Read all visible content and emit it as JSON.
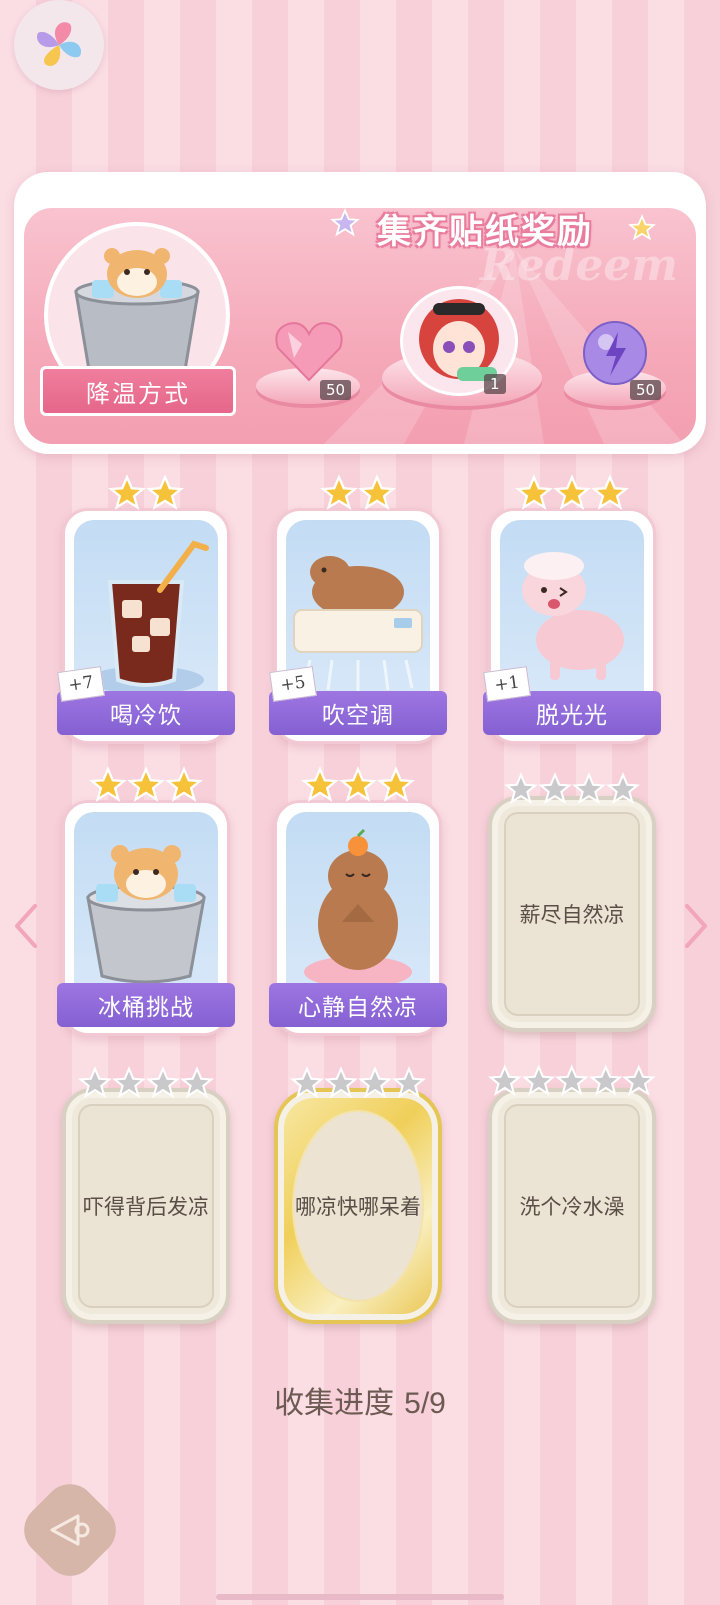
{
  "banner": {
    "title": "集齐贴纸奖励",
    "watermark": "Redeem",
    "method_label": "降温方式",
    "rewards": [
      {
        "icon": "pink-heart-gem-icon",
        "count": "50"
      },
      {
        "icon": "character-avatar-icon",
        "count": "1"
      },
      {
        "icon": "purple-energy-orb-icon",
        "count": "50"
      }
    ]
  },
  "cards": [
    {
      "label": "喝冷饮",
      "bonus": "+7",
      "stars": 2,
      "icon": "iced-cola-icon",
      "collected": true
    },
    {
      "label": "吹空调",
      "bonus": "+5",
      "stars": 2,
      "icon": "capybara-air-conditioner-icon",
      "collected": true
    },
    {
      "label": "脱光光",
      "bonus": "+1",
      "stars": 3,
      "icon": "sheared-sheep-icon",
      "collected": true
    },
    {
      "label": "冰桶挑战",
      "bonus": "",
      "stars": 3,
      "icon": "hamster-ice-bucket-icon",
      "collected": true
    },
    {
      "label": "心静自然凉",
      "bonus": "",
      "stars": 3,
      "icon": "meditating-capybara-icon",
      "collected": true
    },
    {
      "label": "薪尽自然凉",
      "stars": 4,
      "collected": false
    },
    {
      "label": "吓得背后发凉",
      "stars": 4,
      "collected": false
    },
    {
      "label": "哪凉快哪呆着",
      "stars": 4,
      "collected": false,
      "gold": true
    },
    {
      "label": "洗个冷水澡",
      "stars": 5,
      "collected": false
    }
  ],
  "progress": {
    "label": "收集进度",
    "value": "5/9"
  },
  "colors": {
    "accent_pink": "#f07e9d",
    "label_purple": "#8f68d8",
    "star_gold": "#f5c23a",
    "star_grey": "#c9c9cc"
  }
}
